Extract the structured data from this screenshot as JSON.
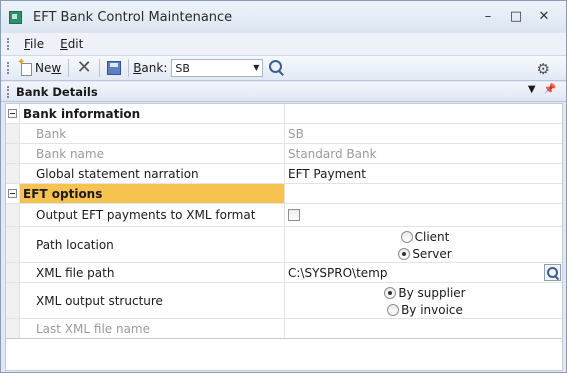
{
  "window": {
    "title": "EFT Bank Control Maintenance",
    "controls": {
      "minimize": "–",
      "maximize": "□",
      "close": "✕"
    }
  },
  "menu": {
    "file": "File",
    "edit": "Edit"
  },
  "toolbar": {
    "new_label": "New",
    "bank_label": "Bank:",
    "bank_value": "SB"
  },
  "panel": {
    "title": "Bank Details"
  },
  "grid": {
    "bank_information": {
      "header": "Bank information",
      "bank": {
        "label": "Bank",
        "value": "SB"
      },
      "bank_name": {
        "label": "Bank name",
        "value": "Standard Bank"
      },
      "narration": {
        "label": "Global statement narration",
        "value": "EFT Payment"
      }
    },
    "eft_options": {
      "header": "EFT options",
      "output_xml": {
        "label": "Output EFT payments to XML format",
        "checked": false
      },
      "path_location": {
        "label": "Path location",
        "options": [
          "Client",
          "Server"
        ],
        "selected": "Server"
      },
      "xml_file_path": {
        "label": "XML file path",
        "value": "C:\\SYSPRO\\temp"
      },
      "xml_output_structure": {
        "label": "XML output structure",
        "options": [
          "By supplier",
          "By invoice"
        ],
        "selected": "By supplier"
      },
      "last_xml_file_name": {
        "label": "Last XML file name",
        "value": ""
      }
    }
  }
}
